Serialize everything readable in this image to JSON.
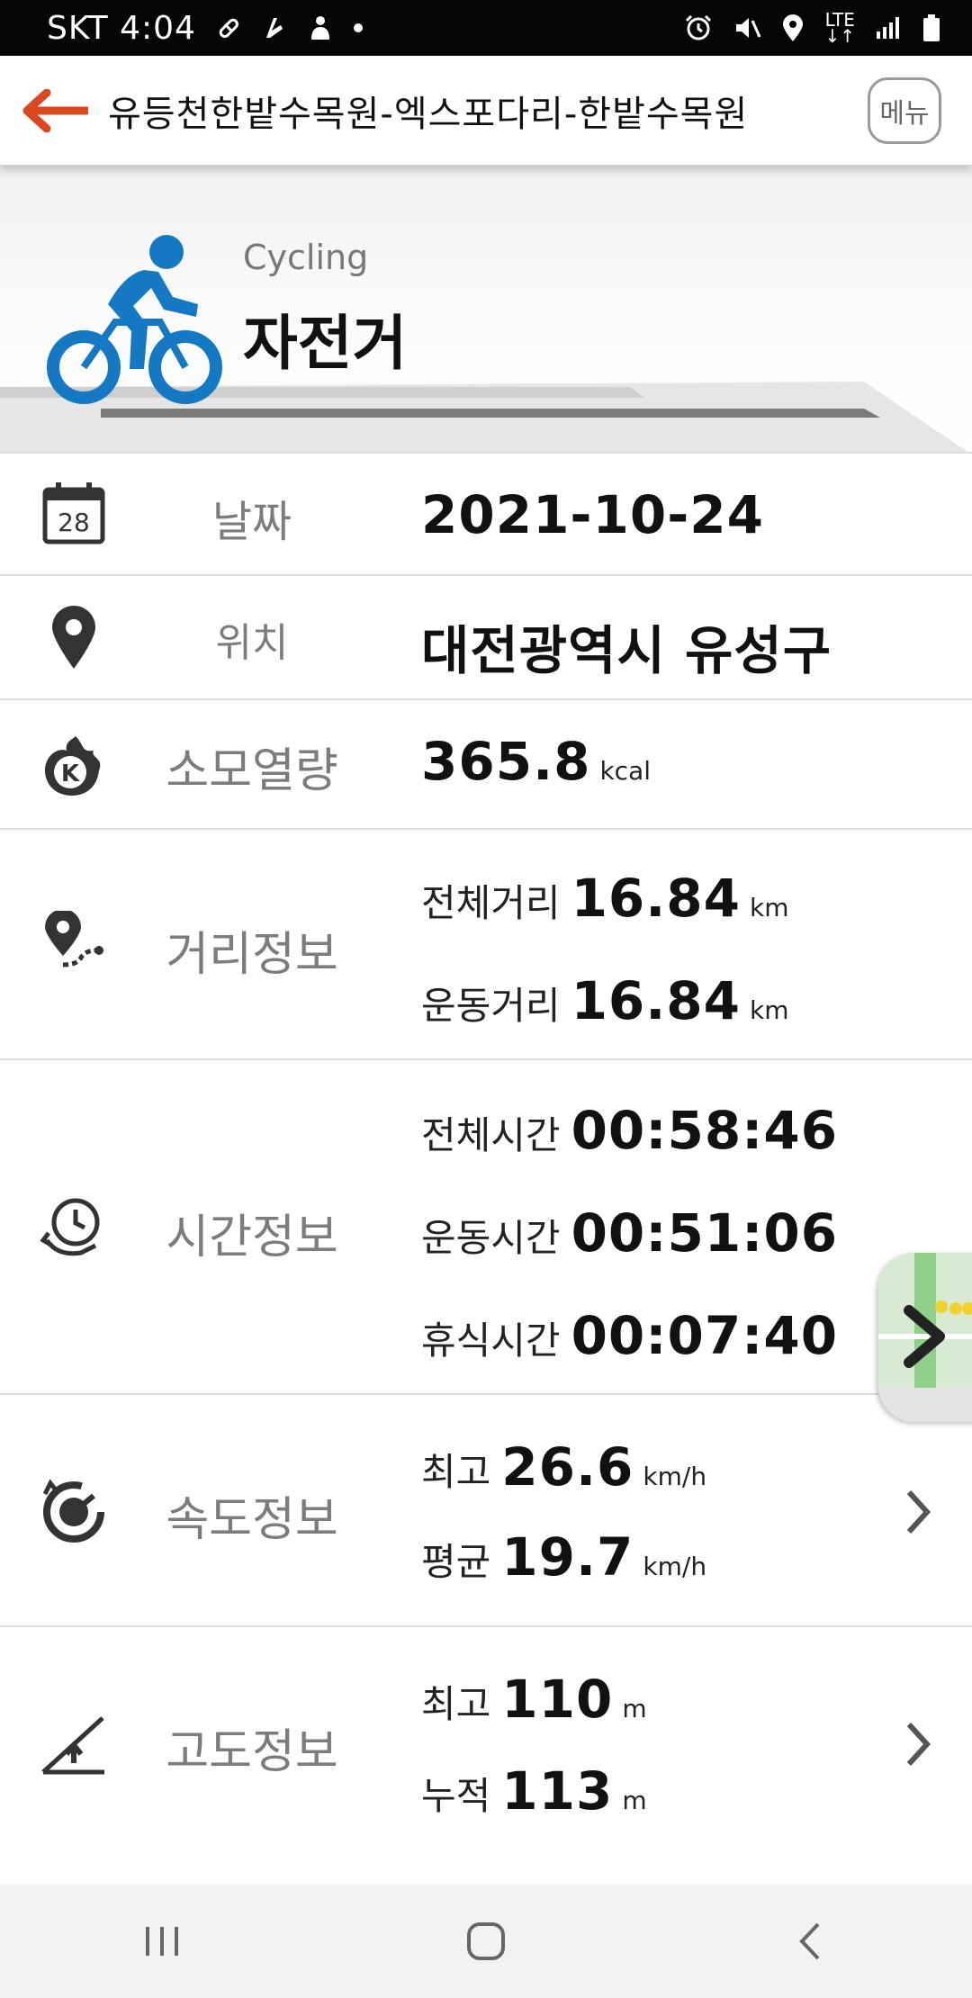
{
  "status_bar": {
    "time_text": "SKT 4:04",
    "network": "LTE",
    "left_icons": [
      "pill-icon",
      "fitness-icon",
      "pet-icon",
      "dot-icon"
    ],
    "right_icons": [
      "alarm-icon",
      "mute-icon",
      "location-icon",
      "lte-icon",
      "signal-icon",
      "battery-icon"
    ]
  },
  "header": {
    "title": "유등천한밭수목원-엑스포다리-한밭수목원",
    "menu_label": "메뉴"
  },
  "banner": {
    "subtitle": "Cycling",
    "title": "자전거",
    "accent_color": "#1479c2"
  },
  "rows": {
    "date": {
      "label": "날짜",
      "value": "2021-10-24",
      "calendar_day": "28"
    },
    "location": {
      "label": "위치",
      "value": "대전광역시 유성구"
    },
    "calories": {
      "label": "소모열량",
      "value": "365.8",
      "unit": "kcal",
      "badge": "K"
    },
    "distance": {
      "label": "거리정보",
      "total_label": "전체거리",
      "total_value": "16.84",
      "total_unit": "km",
      "exercise_label": "운동거리",
      "exercise_value": "16.84",
      "exercise_unit": "km"
    },
    "time": {
      "label": "시간정보",
      "total_label": "전체시간",
      "total_value": "00:58:46",
      "exercise_label": "운동시간",
      "exercise_value": "00:51:06",
      "rest_label": "휴식시간",
      "rest_value": "00:07:40"
    },
    "speed": {
      "label": "속도정보",
      "max_label": "최고",
      "max_value": "26.6",
      "max_unit": "km/h",
      "avg_label": "평균",
      "avg_value": "19.7",
      "avg_unit": "km/h"
    },
    "altitude": {
      "label": "고도정보",
      "max_label": "최고",
      "max_value": "110",
      "max_unit": "m",
      "cum_label": "누적",
      "cum_value": "113",
      "cum_unit": "m"
    }
  },
  "nav": {
    "icons": [
      "recent-apps-icon",
      "home-icon",
      "back-icon"
    ]
  },
  "colors": {
    "back_arrow": "#d9481e",
    "label_gray": "#7c7c7c",
    "status_bg": "#050505"
  }
}
